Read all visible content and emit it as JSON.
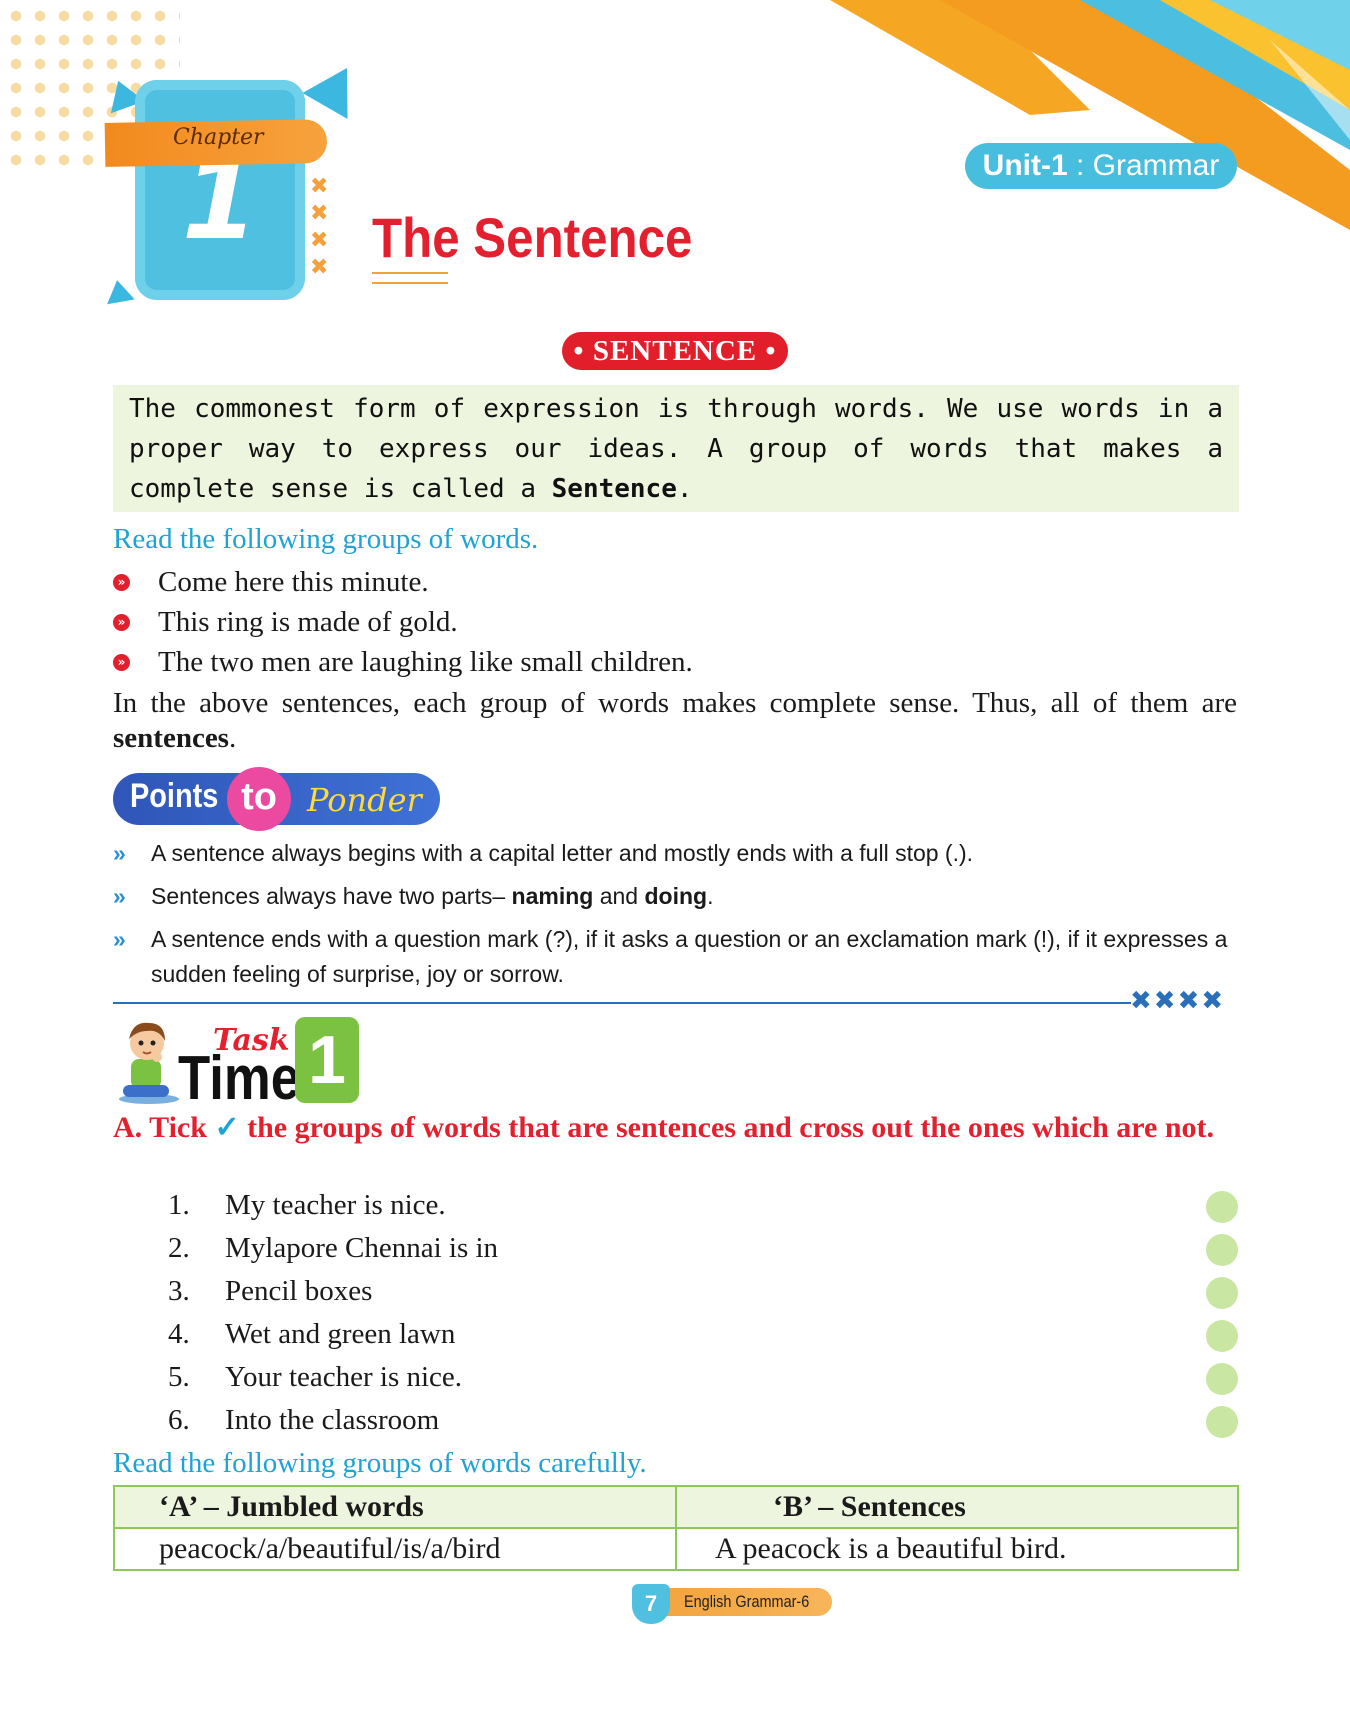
{
  "header": {
    "chapter_label": "Chapter",
    "chapter_number": "1",
    "unit_bold": "Unit-1",
    "unit_rest": " : Grammar",
    "title": "The Sentence"
  },
  "section": {
    "badge": "• SENTENCE •",
    "intro_part1": "The commonest form of expression is through words. We use words in a proper way to express our ideas. A group of words that makes a complete sense is called a ",
    "intro_bold": "Sentence",
    "intro_end": ".",
    "read_heading": "Read the following groups of words.",
    "examples": [
      "Come here this minute.",
      "This ring is made of gold.",
      "The two men are laughing like small children."
    ],
    "para_part1": "In the above sentences, each group of words makes complete sense. Thus, all of them are ",
    "para_bold": "sentences",
    "para_end": "."
  },
  "ponder": {
    "word_points": "Points",
    "word_to": "to",
    "word_ponder": "Ponder",
    "items": [
      {
        "pre": "A sentence always begins with a capital letter and mostly ends with a full stop (.).",
        "b1": "",
        "mid": "",
        "b2": "",
        "post": ""
      },
      {
        "pre": "Sentences always have two parts– ",
        "b1": "naming",
        "mid": " and ",
        "b2": "doing",
        "post": "."
      },
      {
        "pre": "A sentence ends with a question mark (?), if it asks a question or an exclamation mark (!), if it expresses a sudden feeling of surprise, joy or sorrow.",
        "b1": "",
        "mid": "",
        "b2": "",
        "post": ""
      }
    ]
  },
  "task": {
    "task_word": "Task",
    "time_word": "Time",
    "number": "1",
    "instruction_prefix": "A. Tick ",
    "tick_mark": "✓",
    "instruction_rest": " the groups of words that are sentences and cross out the ones which are not.",
    "items": [
      {
        "num": "1.",
        "text": "My teacher is nice."
      },
      {
        "num": "2.",
        "text": "Mylapore Chennai is in"
      },
      {
        "num": "3.",
        "text": "Pencil boxes"
      },
      {
        "num": "4.",
        "text": "Wet and green lawn"
      },
      {
        "num": "5.",
        "text": "Your teacher is nice."
      },
      {
        "num": "6.",
        "text": "Into  the classroom"
      }
    ]
  },
  "jumbled": {
    "heading": "Read the following groups of words carefully.",
    "col_a": "‘A’ – Jumbled words",
    "col_b": "‘B’ – Sentences",
    "row_a": "peacock/a/beautiful/is/a/bird",
    "row_b": "A peacock is a beautiful bird."
  },
  "footer": {
    "page_number": "7",
    "book_title": "English Grammar-6"
  }
}
